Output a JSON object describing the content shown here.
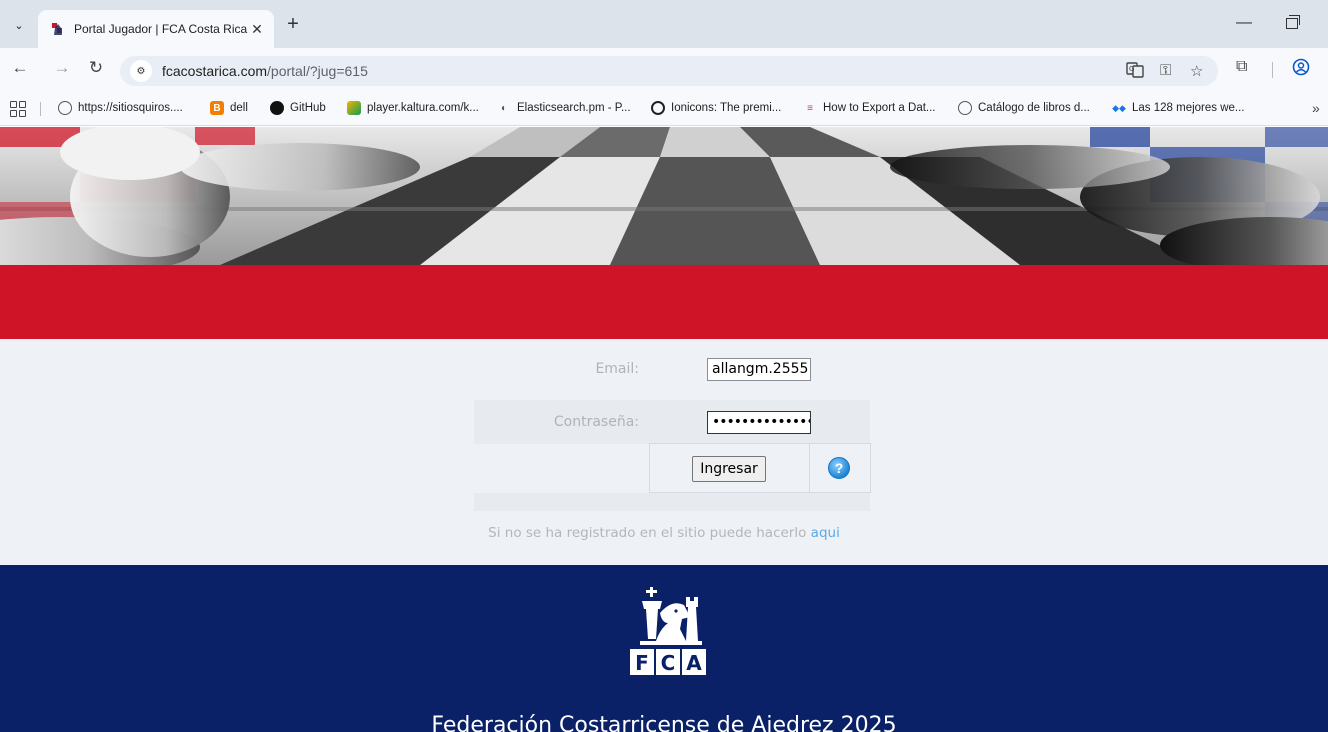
{
  "browser": {
    "tab_title": "Portal Jugador | FCA Costa Rica",
    "url_domain": "fcacostarica.com",
    "url_path": "/portal/?jug=615",
    "bookmarks": [
      {
        "label": "https://sitiosquiros....",
        "icon": "globe-icon"
      },
      {
        "label": "dell",
        "icon": "blogger-icon"
      },
      {
        "label": "GitHub",
        "icon": "github-icon"
      },
      {
        "label": "player.kaltura.com/k...",
        "icon": "kaltura-icon"
      },
      {
        "label": "Elasticsearch.pm - P...",
        "icon": "elastic-icon"
      },
      {
        "label": "Ionicons: The premi...",
        "icon": "ionicons-icon"
      },
      {
        "label": "How to Export a Dat...",
        "icon": "export-icon"
      },
      {
        "label": "Catálogo de libros d...",
        "icon": "globe-icon"
      },
      {
        "label": "Las 128 mejores we...",
        "icon": "bookmark-icon"
      }
    ]
  },
  "form": {
    "email_label": "Email:",
    "email_value": "allangm.2555",
    "password_label": "Contraseña:",
    "password_value": "••••••••••••••",
    "submit_label": "Ingresar",
    "help_glyph": "?",
    "register_text": "Si no se ha registrado en el sitio puede hacerlo ",
    "register_link": "aqui"
  },
  "footer": {
    "logo_text": "FCA",
    "title": "Federación Costarricense de Ajedrez 2025"
  },
  "colors": {
    "red_band": "#d01427",
    "footer_navy": "#0a2168",
    "link": "#5aaae8"
  }
}
